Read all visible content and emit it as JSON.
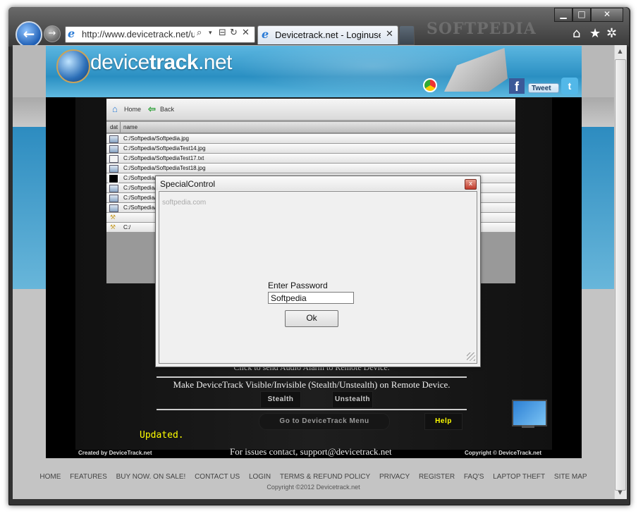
{
  "browser": {
    "url": "http://www.devicetrack.net/u",
    "tab_title": "Devicetrack.net - Loginuser...",
    "tab_close": "✕",
    "watermark": "SOFTPEDIA",
    "window_controls": {
      "minimize": "▁",
      "maximize": "□",
      "close": "✕"
    },
    "toolbar_icons": [
      "home-icon",
      "star-icon",
      "gear-icon"
    ]
  },
  "site": {
    "logo_light": "device",
    "logo_bold": "track",
    "logo_suffix": ".net",
    "tweet_label": "Tweet",
    "fb_label": "f"
  },
  "file_manager": {
    "toolbar": {
      "home_label": "Home",
      "back_label": "Back"
    },
    "columns": [
      "dat",
      "name"
    ],
    "rows": [
      {
        "icon": "image-file-icon",
        "name": "C:/Softpedia/Softpedia.jpg"
      },
      {
        "icon": "image-file-icon",
        "name": "C:/Softpedia/SoftpediaTest14.jpg"
      },
      {
        "icon": "text-file-icon",
        "name": "C:/Softpedia/SoftpediaTest17.txt"
      },
      {
        "icon": "image-file-icon",
        "name": "C:/Softpedia/SoftpediaTest18.jpg"
      },
      {
        "icon": "black-file-icon",
        "name": "C:/Softpedia/"
      },
      {
        "icon": "image-file-icon",
        "name": "C:/Softpedia/"
      },
      {
        "icon": "image-file-icon",
        "name": "C:/Softpedia/"
      },
      {
        "icon": "image-file-icon",
        "name": "C:/Softpedia/"
      },
      {
        "icon": "folder-icon",
        "name": ""
      },
      {
        "icon": "folder-icon",
        "name": "C:/"
      }
    ]
  },
  "page": {
    "alarm_text_clipped": "Click to send Audio Alarm to Remote Device.",
    "visible_text": "Make DeviceTrack Visible/Invisible (Stealth/Unstealth) on Remote Device.",
    "stealth_label": "Stealth",
    "unstealth_label": "Unstealth",
    "goto_menu_label": "Go to DeviceTrack Menu",
    "help_label": "Help",
    "updated_text": "Updated.",
    "created_by": "Created by DeviceTrack.net",
    "issues_text": "For issues contact, support@devicetrack.net",
    "copyright_right": "Copyright © DeviceTrack.net"
  },
  "footer": {
    "nav": [
      "HOME",
      "FEATURES",
      "BUY NOW. ON SALE!",
      "CONTACT US",
      "LOGIN",
      "TERMS & REFUND POLICY",
      "PRIVACY",
      "REGISTER",
      "FAQ'S",
      "LAPTOP THEFT",
      "SITE MAP"
    ],
    "copyright": "Copyright ©2012 Devicetrack.net"
  },
  "dialog": {
    "title": "SpecialControl",
    "close_glyph": "x",
    "password_label": "Enter Password",
    "password_value": "Softpedia",
    "ok_label": "Ok",
    "watermark": "softpedia.com"
  }
}
